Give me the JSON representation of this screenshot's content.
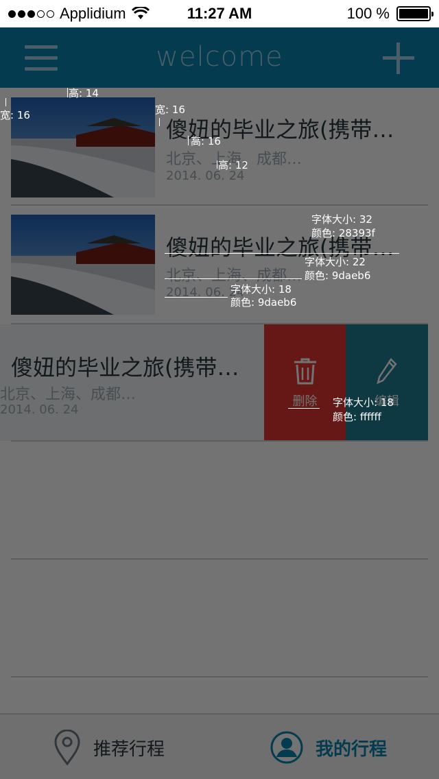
{
  "status_bar": {
    "carrier": "Applidium",
    "time": "11:27 AM",
    "battery": "100 %",
    "signal_icon": "signal-dots-icon",
    "wifi_icon": "wifi-icon"
  },
  "nav": {
    "title": "welcome",
    "menu_icon": "menu-icon",
    "add_icon": "plus-icon"
  },
  "trips": [
    {
      "title": "傻妞的毕业之旅(携带…",
      "cities": "北京、上海、成都…",
      "date": "2014. 06. 24"
    },
    {
      "title": "傻妞的毕业之旅(携带…",
      "cities": "北京、上海、成都…",
      "date": "2014. 06. 24"
    },
    {
      "title": "傻妞的毕业之旅(携带…",
      "cities": "北京、上海、成都…",
      "date": "2014. 06. 24"
    }
  ],
  "swipe_actions": {
    "delete_label": "删除",
    "edit_label": "编辑",
    "delete_color": "#e0362f",
    "edit_color": "#1f7e96"
  },
  "tabbar": {
    "recommend_label": "推荐行程",
    "mine_label": "我的行程",
    "active_color": "#0a83b0"
  },
  "annotations": {
    "height_14": "高: 14",
    "width_16_a": "宽: 16",
    "width_16_b": "宽: 16",
    "height_16": "高: 16",
    "height_12": "高: 12",
    "title_size": "字体大小: 32",
    "title_color": "颜色: 28393f",
    "cities_size": "字体大小: 22",
    "cities_color": "颜色: 9daeb6",
    "date_size": "字体大小: 18",
    "date_color": "颜色: 9daeb6",
    "action_size": "字体大小: 18",
    "action_color": "颜色: ffffff"
  }
}
